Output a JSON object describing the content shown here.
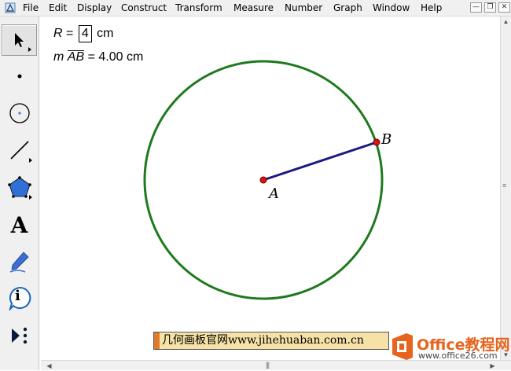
{
  "menu": {
    "items": [
      "File",
      "Edit",
      "Display",
      "Construct",
      "Transform",
      "Measure",
      "Number",
      "Graph",
      "Window",
      "Help"
    ]
  },
  "toolbar": {
    "tools": [
      "arrow-select-tool",
      "point-tool",
      "compass-tool",
      "straightedge-tool",
      "polygon-tool",
      "text-tool",
      "marker-tool",
      "information-tool",
      "custom-tool"
    ],
    "text_tool_glyph": "A",
    "info_tool_glyph": "i"
  },
  "canvas": {
    "radius_param": {
      "name": "R",
      "equals": "=",
      "value": "4",
      "unit": "cm"
    },
    "arc_measure": {
      "prefix": "m",
      "arc": "AB",
      "equals": "=",
      "value": "4.00 cm"
    },
    "points": [
      {
        "label": "A",
        "role": "center"
      },
      {
        "label": "B",
        "role": "on-circle"
      }
    ],
    "colors": {
      "circle": "#1e7a1e",
      "segment": "#1a1a80",
      "point": "#e01010"
    }
  },
  "watermark": {
    "text": "几何画板官网www.jihehuaban.com.cn"
  },
  "logo": {
    "brand": "Office教程网",
    "url": "www.office26.com",
    "colors": {
      "brand": "#e6641e"
    }
  }
}
